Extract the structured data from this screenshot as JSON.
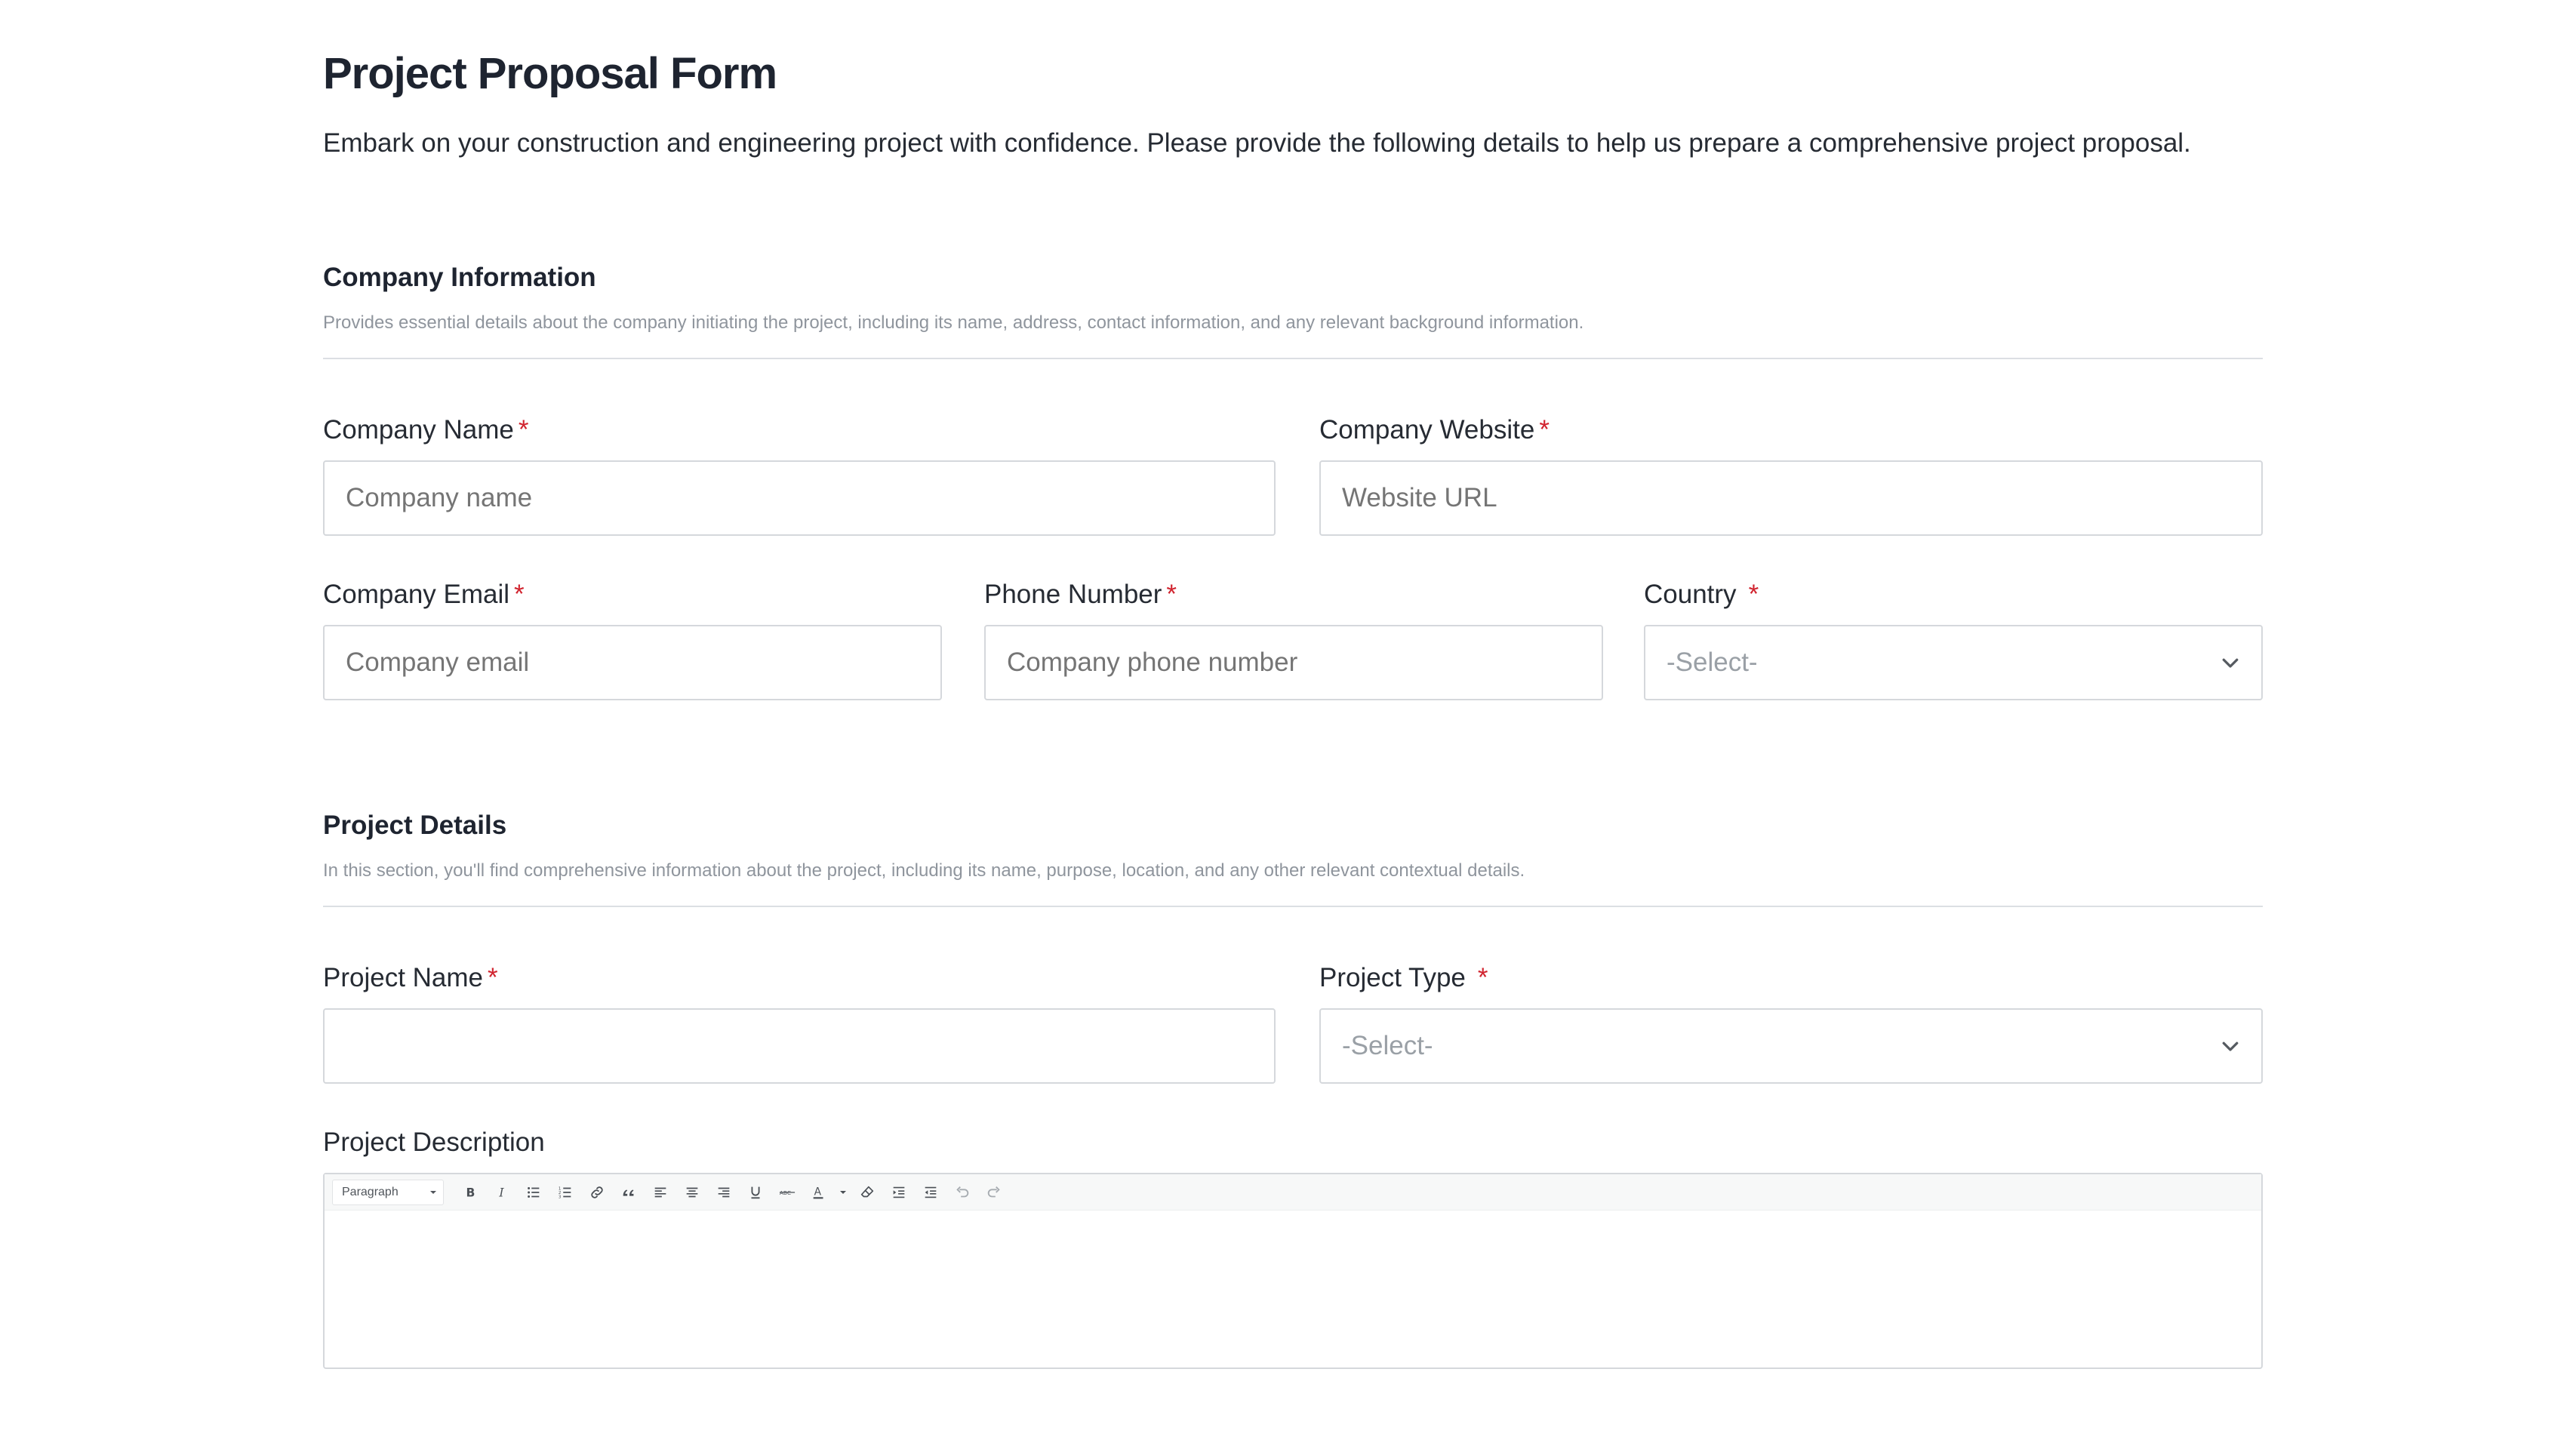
{
  "form": {
    "title": "Project Proposal Form",
    "intro": "Embark on your construction and engineering project with confidence. Please provide the following details to help us prepare a comprehensive project proposal."
  },
  "company_section": {
    "title": "Company Information",
    "description": "Provides essential details about the company initiating the project, including its name, address, contact information, and any relevant background information.",
    "fields": {
      "company_name": {
        "label": "Company Name",
        "required": "*",
        "placeholder": "Company name",
        "value": ""
      },
      "company_website": {
        "label": "Company Website",
        "required": "*",
        "placeholder": "Website URL",
        "value": ""
      },
      "company_email": {
        "label": "Company Email",
        "required": "*",
        "placeholder": "Company email",
        "value": ""
      },
      "phone_number": {
        "label": "Phone Number",
        "required": "*",
        "placeholder": "Company phone number",
        "value": ""
      },
      "country": {
        "label": "Country",
        "required": "*",
        "selected": "-Select-"
      }
    }
  },
  "project_section": {
    "title": "Project Details",
    "description": "In this section, you'll find comprehensive information about the project, including its name, purpose, location, and any other relevant contextual details.",
    "fields": {
      "project_name": {
        "label": "Project Name",
        "required": "*",
        "placeholder": "",
        "value": ""
      },
      "project_type": {
        "label": "Project Type",
        "required": "*",
        "selected": "-Select-"
      },
      "project_description": {
        "label": "Project Description",
        "toolbar": {
          "block_format": "Paraph",
          "block_format_full": "Paragraph",
          "buttons": [
            "bold-icon",
            "italic-icon",
            "bullet-list-icon",
            "numbered-list-icon",
            "link-icon",
            "blockquote-icon",
            "align-left-icon",
            "align-center-icon",
            "align-right-icon",
            "underline-icon",
            "strikethrough-icon",
            "text-color-icon",
            "clear-format-icon",
            "indent-icon",
            "outdent-icon",
            "undo-icon",
            "redo-icon"
          ]
        }
      }
    }
  },
  "colors": {
    "required": "#d1242f",
    "border": "#d5d8dc",
    "placeholder": "#9aa0a6",
    "heading": "#1e2430"
  }
}
